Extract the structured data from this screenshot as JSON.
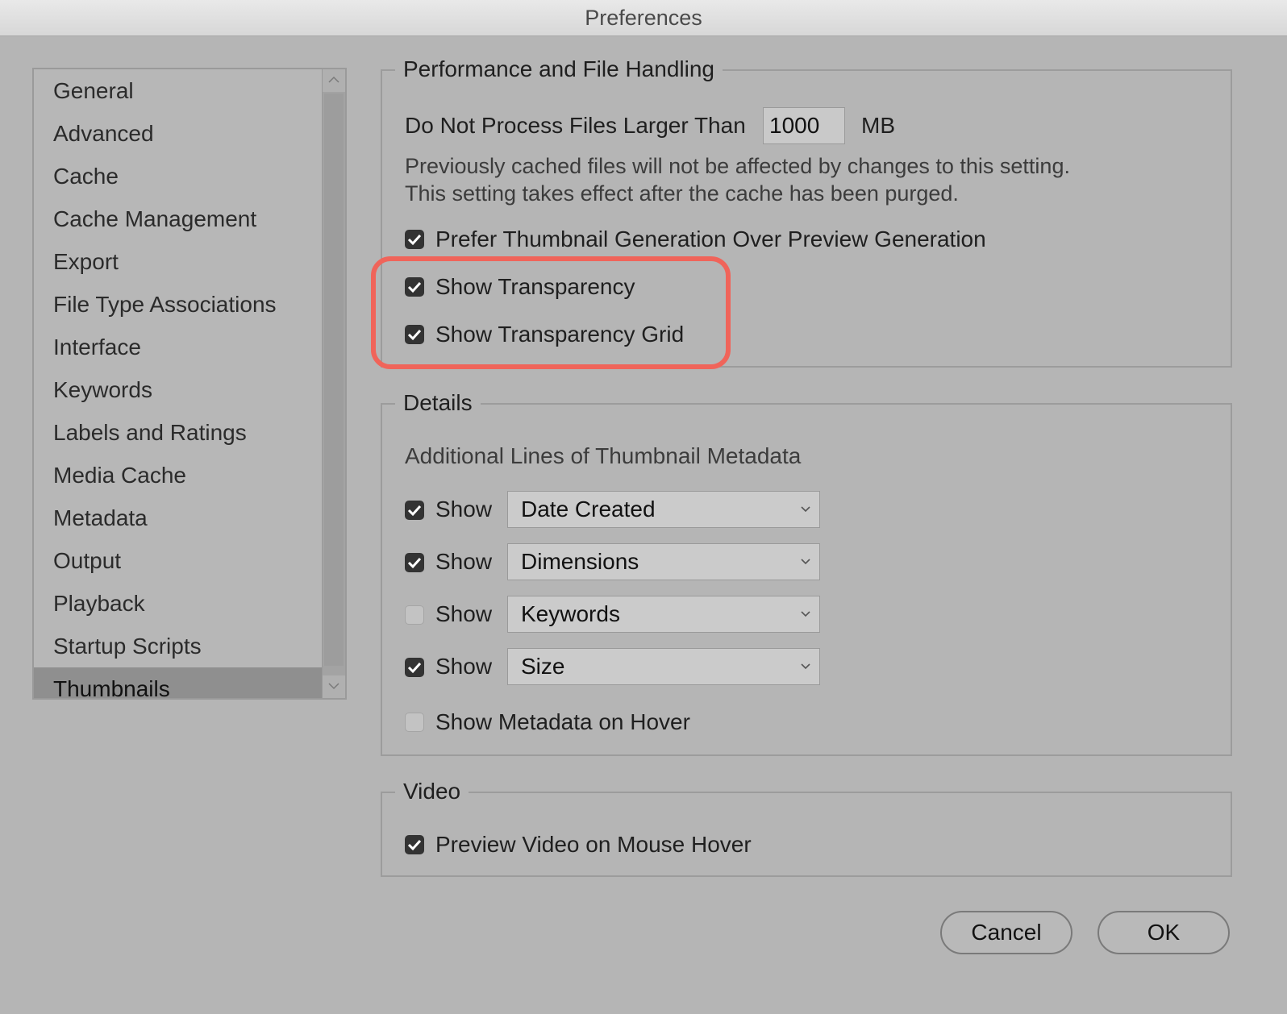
{
  "window": {
    "title": "Preferences"
  },
  "sidebar": {
    "items": [
      {
        "label": "General"
      },
      {
        "label": "Advanced"
      },
      {
        "label": "Cache"
      },
      {
        "label": "Cache Management"
      },
      {
        "label": "Export"
      },
      {
        "label": "File Type Associations"
      },
      {
        "label": "Interface"
      },
      {
        "label": "Keywords"
      },
      {
        "label": "Labels and Ratings"
      },
      {
        "label": "Media Cache"
      },
      {
        "label": "Metadata"
      },
      {
        "label": "Output"
      },
      {
        "label": "Playback"
      },
      {
        "label": "Startup Scripts"
      },
      {
        "label": "Thumbnails"
      }
    ],
    "selected": "Thumbnails"
  },
  "performance": {
    "title": "Performance and File Handling",
    "max_size_label": "Do Not Process Files Larger Than",
    "max_size_value": "1000",
    "max_size_unit": "MB",
    "note_line1": "Previously cached files will not be affected by changes to this setting.",
    "note_line2": "This setting takes effect after the cache has been purged.",
    "prefer_thumbnail": {
      "label": "Prefer Thumbnail Generation Over Preview Generation",
      "checked": true
    },
    "show_transparency": {
      "label": "Show Transparency",
      "checked": true
    },
    "show_transparency_grid": {
      "label": "Show Transparency Grid",
      "checked": true
    }
  },
  "details": {
    "title": "Details",
    "subtitle": "Additional Lines of Thumbnail Metadata",
    "metadata_rows": [
      {
        "show_label": "Show",
        "checked": true,
        "value": "Date Created"
      },
      {
        "show_label": "Show",
        "checked": true,
        "value": "Dimensions"
      },
      {
        "show_label": "Show",
        "checked": false,
        "value": "Keywords"
      },
      {
        "show_label": "Show",
        "checked": true,
        "value": "Size"
      }
    ],
    "show_on_hover": {
      "label": "Show Metadata on Hover",
      "checked": false
    }
  },
  "video": {
    "title": "Video",
    "preview_on_hover": {
      "label": "Preview Video on Mouse Hover",
      "checked": true
    }
  },
  "buttons": {
    "cancel": "Cancel",
    "ok": "OK"
  },
  "colors": {
    "highlight": "#f0645a",
    "background": "#b5b5b5"
  }
}
